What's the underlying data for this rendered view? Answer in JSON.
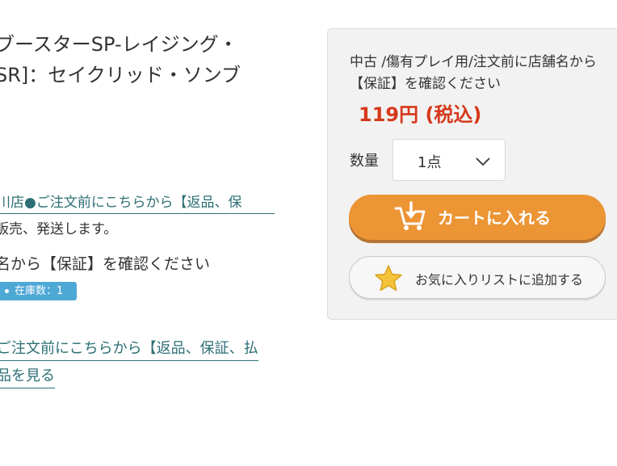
{
  "product": {
    "title_line1": "ブースターSP-レイジング・",
    "title_line2": "SR]：セイクリッド・ソンブ"
  },
  "details": {
    "store_link": "川店●ご注文前にこちらから【返品、保",
    "shipping_note": "販売、発送します。",
    "warranty_note": "名から【保証】を確認ください",
    "stock_label": "在庫数：1",
    "notice_link": "ご注文前にこちらから【返品、保証、払",
    "more_link": "品を見る"
  },
  "buy_box": {
    "condition": "中古 /傷有プレイ用/注文前に店舗名から【保証】を確認ください",
    "price": "119円 (税込)",
    "quantity_label": "数量",
    "quantity_value": "1点",
    "cart_button": "カートに入れる",
    "favorite_button": "お気に入りリストに追加する"
  },
  "colors": {
    "link": "#2d6f74",
    "price": "#d6391b",
    "cart_button": "#ec9535",
    "stock_tag": "#4ea8d6",
    "star": "#f5c23a"
  },
  "icons": {
    "cart": "cart-download-icon",
    "star": "star-icon",
    "chevron": "chevron-down-icon"
  }
}
